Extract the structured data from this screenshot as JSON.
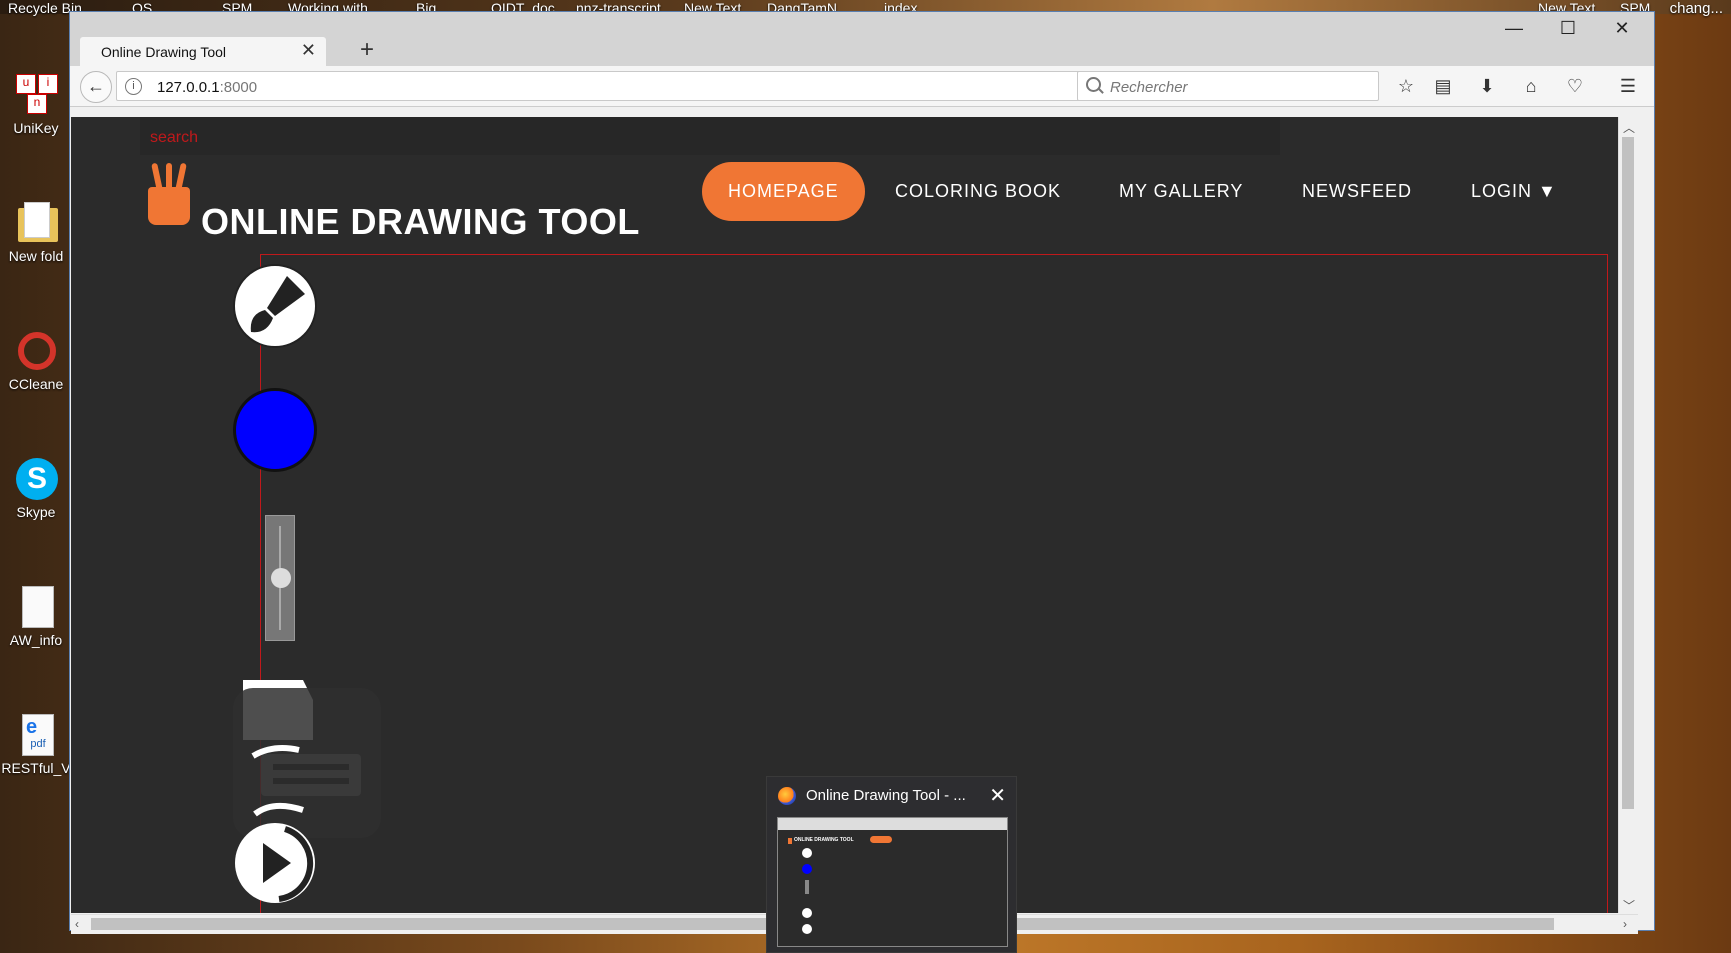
{
  "desktop": {
    "top_labels": [
      "Recycle Bin",
      "OS",
      "SPM",
      "Working with",
      "Big",
      "OIDT_doc",
      "nnz-transcript",
      "New Text",
      "DangTamN",
      "index",
      "New Text",
      "SPM"
    ],
    "corner_text": "chang...",
    "icons": [
      {
        "label": "UniKey"
      },
      {
        "label": "New fold"
      },
      {
        "label": "CCleane"
      },
      {
        "label": "Skype"
      },
      {
        "label": "AW_info"
      },
      {
        "label": "RESTful_V"
      }
    ]
  },
  "browser": {
    "tab_title": "Online Drawing Tool",
    "url_host": "127.0.0.1",
    "url_port": ":8000",
    "search_placeholder": "Rechercher"
  },
  "page": {
    "search_placeholder": "search",
    "logo_text": "ONLINE DRAWING TOOL",
    "menu": {
      "homepage": "HOMEPAGE",
      "coloring_book": "COLORING BOOK",
      "my_gallery": "MY GALLERY",
      "newsfeed": "NEWSFEED",
      "login": "LOGIN ▼"
    },
    "current_color": "#0000ff",
    "brush_size_level": 0.5
  },
  "taskbar_preview": {
    "title": "Online Drawing Tool - ...",
    "thumb_logo": "ONLINE DRAWING TOOL"
  },
  "colors": {
    "accent": "#f07634",
    "page_bg": "#2b2b2b",
    "canvas_border": "#c0191b"
  }
}
